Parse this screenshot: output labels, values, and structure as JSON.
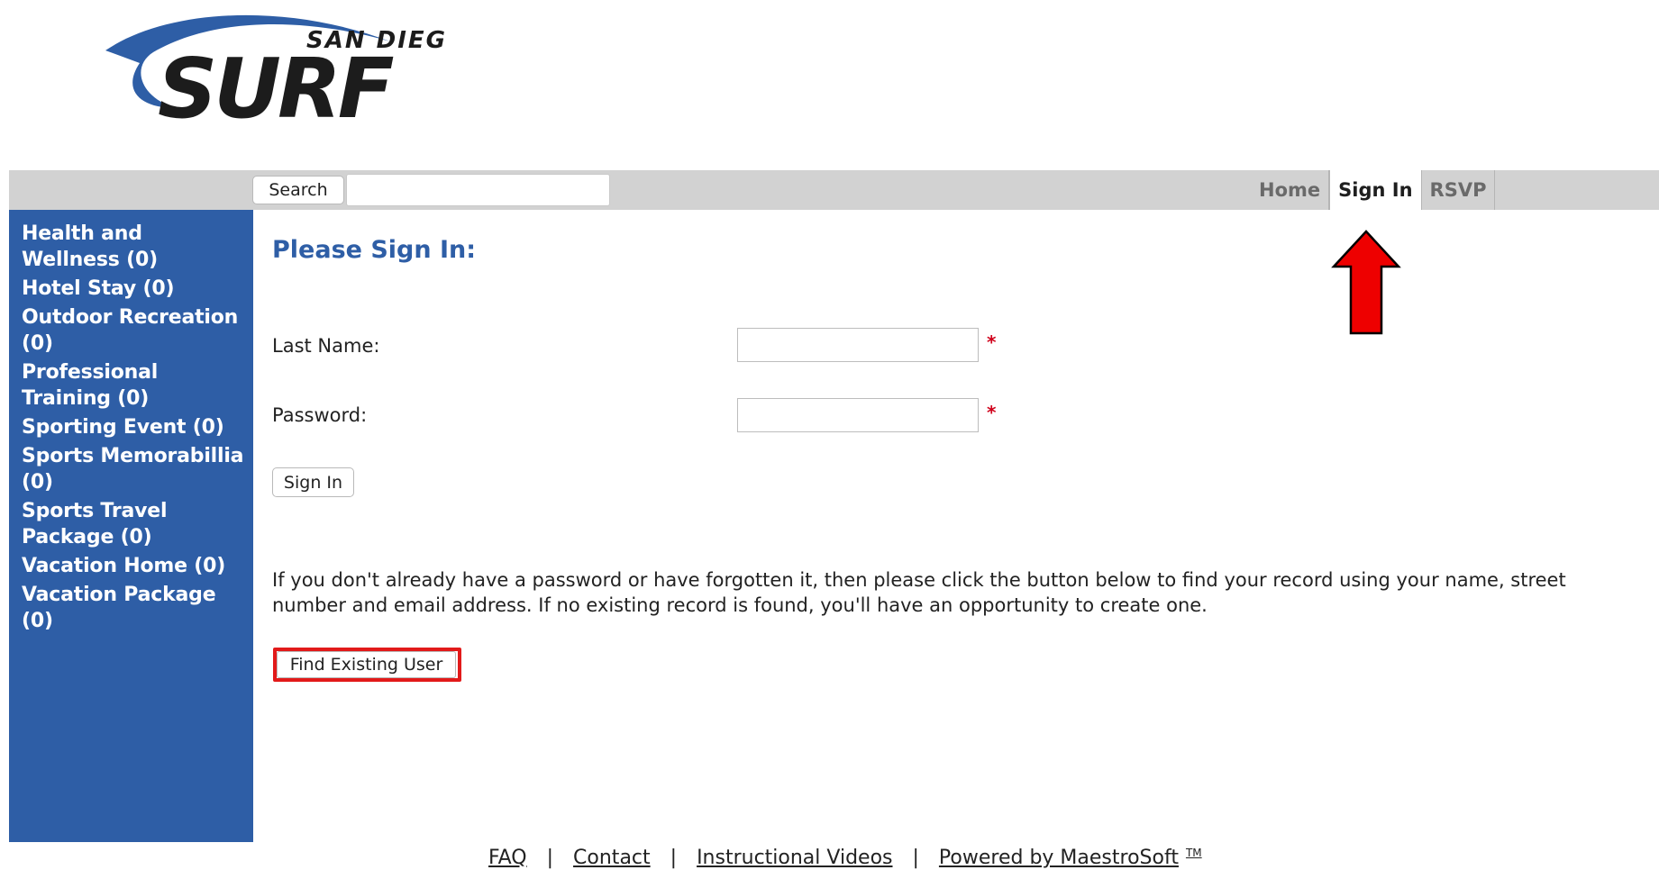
{
  "logo": {
    "city": "SAN DIEGO",
    "brand": "SURF",
    "color_blue": "#2e5ea6",
    "color_dark": "#1c1c1c"
  },
  "navbar": {
    "search_button": "Search",
    "search_value": "",
    "links": [
      {
        "label": "Home",
        "active": false
      },
      {
        "label": "Sign In",
        "active": true
      },
      {
        "label": "RSVP",
        "active": false
      }
    ]
  },
  "sidebar": {
    "categories": [
      "Health and Wellness (0)",
      "Hotel Stay (0)",
      "Outdoor Recreation (0)",
      "Professional Training (0)",
      "Sporting Event (0)",
      "Sports Memorabillia (0)",
      "Sports Travel Package (0)",
      "Vacation Home (0)",
      "Vacation Package (0)"
    ]
  },
  "main": {
    "title": "Please Sign In:",
    "last_name_label": "Last Name:",
    "last_name_value": "",
    "password_label": "Password:",
    "password_value": "",
    "required_marker": "*",
    "sign_in_button": "Sign In",
    "info_text": "If you don't already have a password or have forgotten it, then please click the button below to find your record using your name, street number and email address. If no existing record is found, you'll have an opportunity to create one.",
    "find_user_button": "Find Existing User"
  },
  "annotations": {
    "arrow_icon": "up-arrow-icon",
    "highlight_color": "#e21a1a"
  },
  "footer": {
    "links": [
      "FAQ",
      "Contact",
      "Instructional Videos",
      "Powered by MaestroSoft"
    ],
    "separator": "|",
    "trademark": "TM"
  }
}
